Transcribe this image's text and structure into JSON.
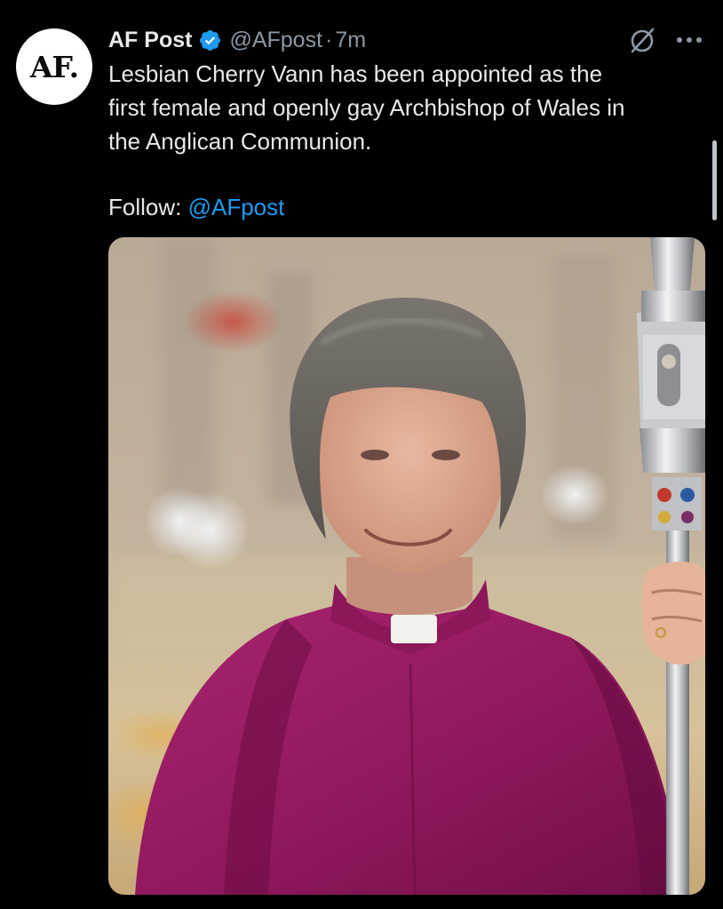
{
  "tweet": {
    "avatar_text": "AF.",
    "display_name": "AF Post",
    "verified": true,
    "handle": "@AFpost",
    "separator": "·",
    "time": "7m",
    "text_lines": [
      "Lesbian Cherry Vann has been appointed as the",
      "first female and openly gay Archbishop of Wales in",
      "the Anglican Communion."
    ],
    "follow_label": "Follow: ",
    "follow_mention": "@AFpost"
  },
  "icons": {
    "verified": "verified-badge-icon",
    "grok": "grok-icon",
    "more": "more-options-icon"
  },
  "colors": {
    "background": "#000000",
    "text": "#e7e9ea",
    "secondary_text": "#8b98a5",
    "link": "#1d9bf0",
    "verified_badge": "#1d9bf0"
  }
}
